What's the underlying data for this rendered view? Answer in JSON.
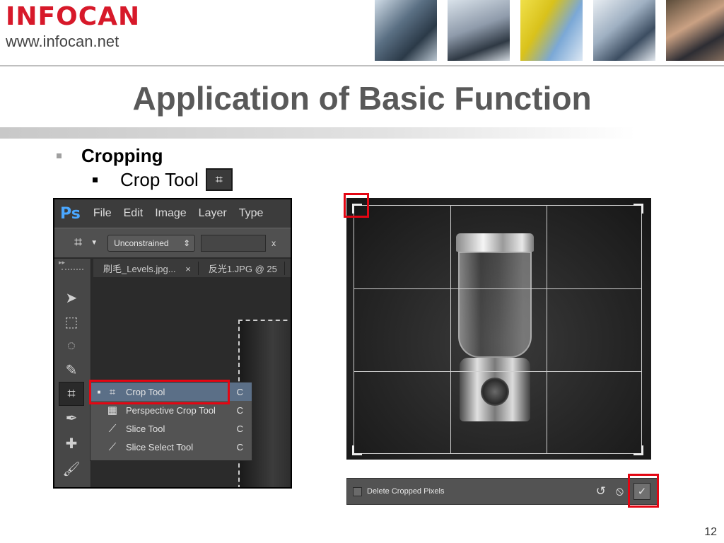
{
  "header": {
    "logo_text": "INFOCAN",
    "logo_url": "www.infocan.net"
  },
  "slide": {
    "title": "Application of Basic Function",
    "bullet1": "Cropping",
    "bullet2": "Crop Tool",
    "page_number": "12"
  },
  "photoshop": {
    "logo": "Ps",
    "menu": [
      "File",
      "Edit",
      "Image",
      "Layer",
      "Type"
    ],
    "options": {
      "ratio_select": "Unconstrained",
      "x_label": "x"
    },
    "tabs": [
      "刷毛_Levels.jpg...",
      "反光1.JPG @ 25"
    ],
    "tab_close": "×",
    "flyout": [
      {
        "label": "Crop Tool",
        "shortcut": "C",
        "selected": true,
        "icon": "crop-icon"
      },
      {
        "label": "Perspective Crop Tool",
        "shortcut": "C",
        "selected": false,
        "icon": "perspective-crop-icon"
      },
      {
        "label": "Slice Tool",
        "shortcut": "C",
        "selected": false,
        "icon": "slice-icon"
      },
      {
        "label": "Slice Select Tool",
        "shortcut": "C",
        "selected": false,
        "icon": "slice-select-icon"
      }
    ]
  },
  "crop_options": {
    "delete_cropped_label": "Delete Cropped Pixels"
  },
  "colors": {
    "highlight": "#e30613",
    "logo_red": "#d7192a",
    "ps_blue": "#4aa7ff"
  }
}
